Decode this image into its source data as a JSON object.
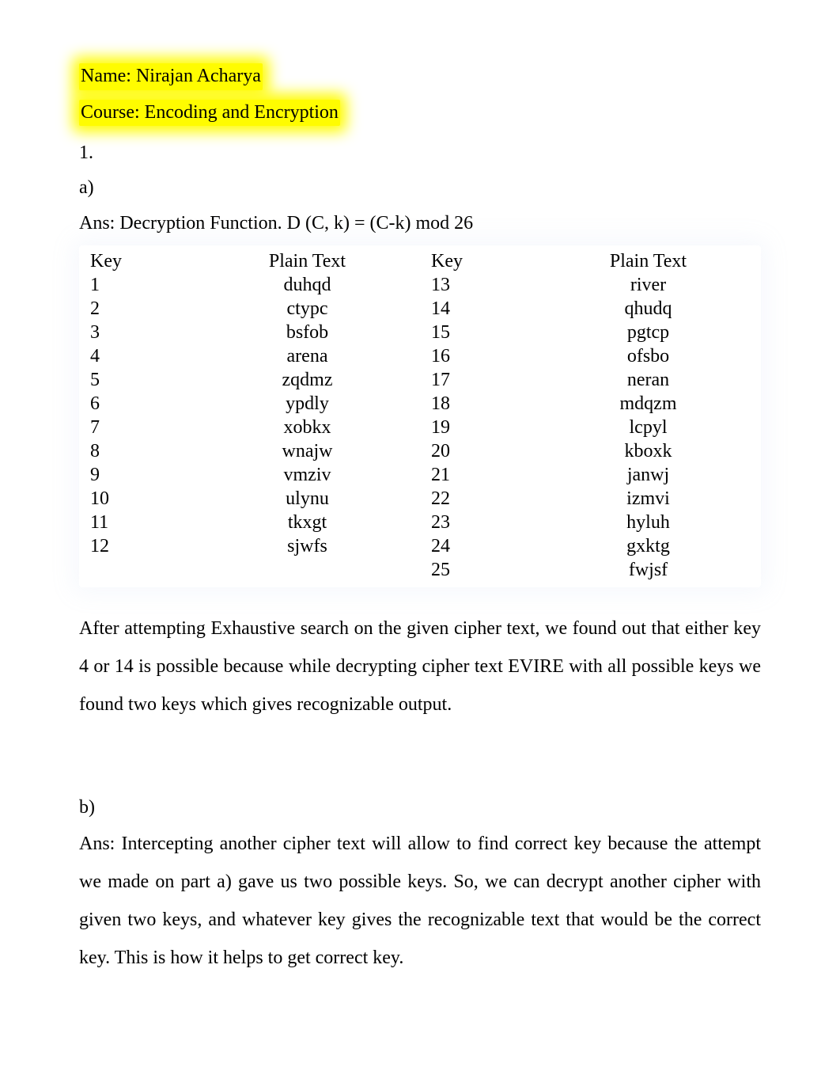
{
  "header": {
    "name_line": "Name: Nirajan Acharya",
    "course_line": "Course: Encoding and Encryption"
  },
  "q1": {
    "number": "1.",
    "part_a": {
      "label": "a)",
      "ans_prefix": "Ans: Decryption Function. D (C, k) = (C-k) mod 26",
      "headers": {
        "key": "Key",
        "plain": "Plain Text"
      },
      "left": [
        {
          "key": "1",
          "plain": "duhqd"
        },
        {
          "key": "2",
          "plain": "ctypc"
        },
        {
          "key": "3",
          "plain": "bsfob"
        },
        {
          "key": "4",
          "plain": "arena"
        },
        {
          "key": "5",
          "plain": "zqdmz"
        },
        {
          "key": "6",
          "plain": "ypdly"
        },
        {
          "key": "7",
          "plain": "xobkx"
        },
        {
          "key": "8",
          "plain": "wnajw"
        },
        {
          "key": "9",
          "plain": "vmziv"
        },
        {
          "key": "10",
          "plain": "ulynu"
        },
        {
          "key": "11",
          "plain": "tkxgt"
        },
        {
          "key": "12",
          "plain": "sjwfs"
        }
      ],
      "right": [
        {
          "key": "13",
          "plain": "river"
        },
        {
          "key": "14",
          "plain": "qhudq"
        },
        {
          "key": "15",
          "plain": "pgtcp"
        },
        {
          "key": "16",
          "plain": "ofsbo"
        },
        {
          "key": "17",
          "plain": "neran"
        },
        {
          "key": "18",
          "plain": "mdqzm"
        },
        {
          "key": "19",
          "plain": "lcpyl"
        },
        {
          "key": "20",
          "plain": "kboxk"
        },
        {
          "key": "21",
          "plain": "janwj"
        },
        {
          "key": "22",
          "plain": "izmvi"
        },
        {
          "key": "23",
          "plain": "hyluh"
        },
        {
          "key": "24",
          "plain": "gxktg"
        },
        {
          "key": "25",
          "plain": "fwjsf"
        }
      ],
      "explanation": "After attempting Exhaustive search on the given cipher text, we found out that either key 4 or 14 is possible because while decrypting cipher text EVIRE with all possible keys we found two keys which gives recognizable output."
    },
    "part_b": {
      "label": "b)",
      "answer": "Ans: Intercepting another cipher text will allow to find correct key because the attempt we made on part a) gave us two possible keys. So, we can decrypt another cipher with given two keys, and whatever key gives the recognizable text that would be the correct key. This is how it helps to get correct key."
    }
  }
}
